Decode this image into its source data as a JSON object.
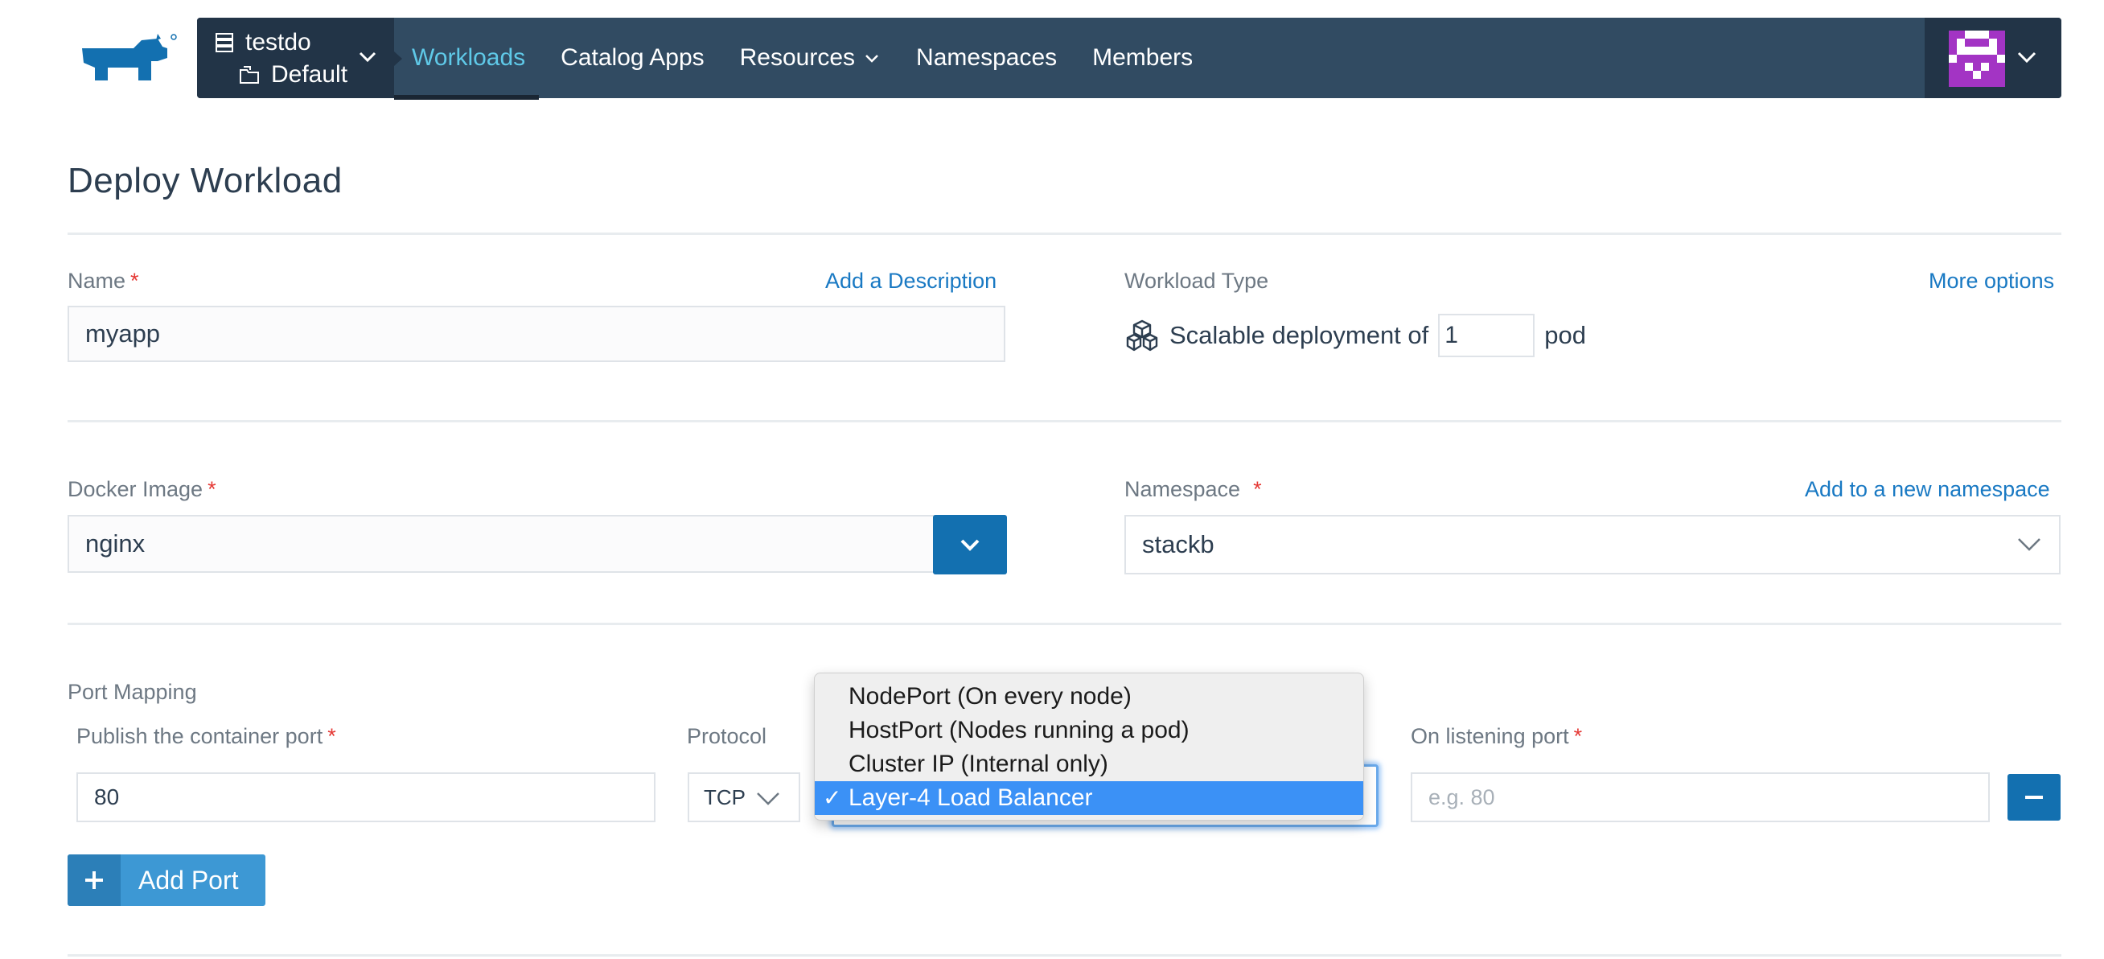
{
  "header": {
    "cluster_name": "testdo",
    "project_name": "Default",
    "nav": [
      {
        "label": "Workloads",
        "active": true
      },
      {
        "label": "Catalog Apps"
      },
      {
        "label": "Resources",
        "dropdown": true
      },
      {
        "label": "Namespaces"
      },
      {
        "label": "Members"
      }
    ]
  },
  "page": {
    "title": "Deploy Workload"
  },
  "form": {
    "name": {
      "label": "Name",
      "required_mark": "*",
      "value": "myapp",
      "add_description_link": "Add a Description"
    },
    "workload_type": {
      "label": "Workload Type",
      "more_options_link": "More options",
      "prefix": "Scalable deployment of",
      "count": "1",
      "suffix": "pod"
    },
    "docker_image": {
      "label": "Docker Image",
      "required_mark": "*",
      "value": "nginx"
    },
    "namespace": {
      "label": "Namespace",
      "required_mark": "*",
      "value": "stackb",
      "add_namespace_link": "Add to a new namespace"
    },
    "port_mapping": {
      "label": "Port Mapping",
      "publish_label": "Publish the container port",
      "required_mark": "*",
      "port_value": "80",
      "protocol_label": "Protocol",
      "protocol_value": "TCP",
      "listening_label": "On listening port",
      "listening_placeholder": "e.g. 80",
      "service_options": [
        "NodePort (On every node)",
        "HostPort (Nodes running a pod)",
        "Cluster IP (Internal only)",
        "Layer-4 Load Balancer"
      ],
      "selected_option_index": 3,
      "check_glyph": "✓",
      "add_port_label": "Add Port"
    }
  },
  "colors": {
    "nav_bg": "#314b62",
    "nav_dark": "#223447",
    "active_link": "#5fc9e8",
    "primary": "#1370b0",
    "link": "#1979c3",
    "required": "#e53935",
    "selection": "#3b91f6"
  }
}
